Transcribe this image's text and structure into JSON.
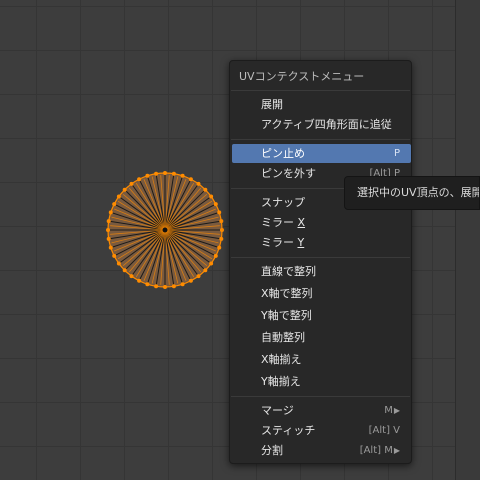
{
  "menu": {
    "title": "UVコンテクストメニュー",
    "items": [
      {
        "label": "展開"
      },
      {
        "label": "アクティブ四角形面に追従"
      },
      {
        "label": "ピン止め",
        "shortcut": "P"
      },
      {
        "label": "ピンを外す",
        "shortcut": "[Alt] P"
      },
      {
        "label": "スナップ"
      },
      {
        "label_prefix": "ミラー ",
        "label_key": "X"
      },
      {
        "label_prefix": "ミラー ",
        "label_key": "Y"
      },
      {
        "label": "直線で整列"
      },
      {
        "label": "X軸で整列"
      },
      {
        "label": "Y軸で整列"
      },
      {
        "label": "自動整列"
      },
      {
        "label": "X軸揃え"
      },
      {
        "label": "Y軸揃え"
      },
      {
        "label": "マージ",
        "shortcut": "M"
      },
      {
        "label": "スティッチ",
        "shortcut": "[Alt] V"
      },
      {
        "label": "分割",
        "shortcut": "[Alt] M"
      }
    ],
    "submenu_arrow": "▶"
  },
  "tooltip": {
    "text": "選択中のUV頂点の、展開"
  },
  "colors": {
    "accent": "#5378b0",
    "uv_edge": "#ff8c00"
  }
}
